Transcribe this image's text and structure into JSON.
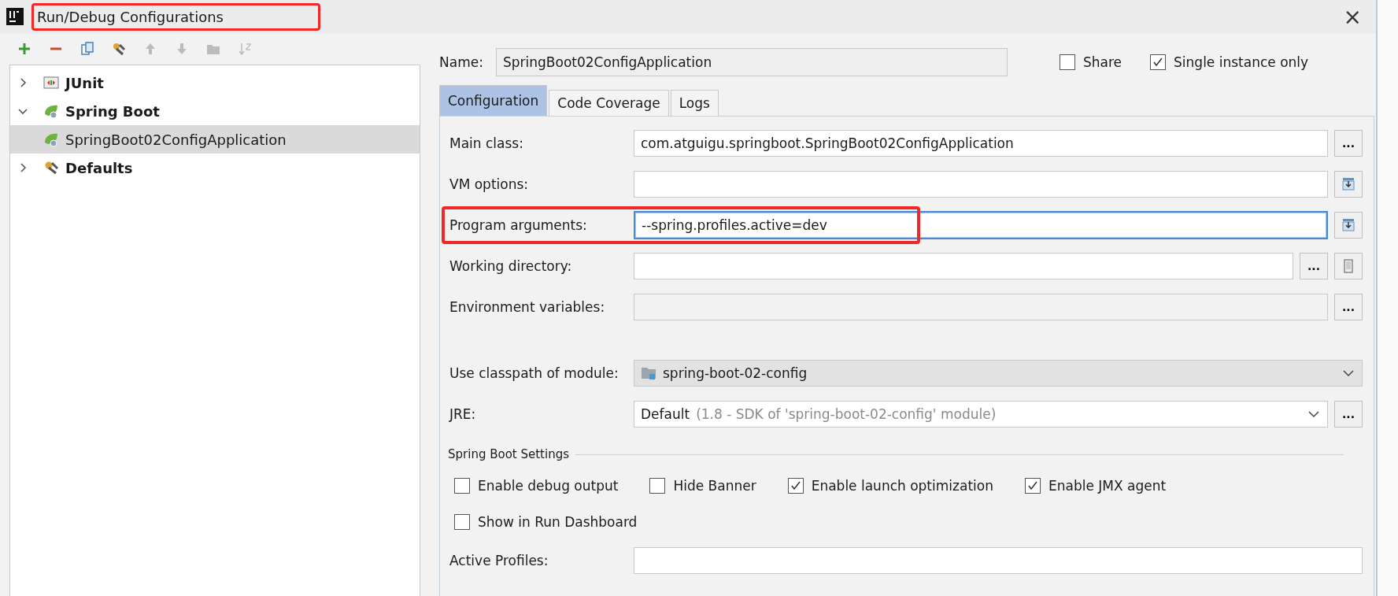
{
  "window": {
    "title": "Run/Debug Configurations",
    "highlighted": true,
    "close": "×"
  },
  "toolbar": [
    {
      "kind": "add",
      "disabled": false
    },
    {
      "kind": "remove",
      "disabled": false
    },
    {
      "kind": "copy",
      "disabled": false
    },
    {
      "kind": "edit",
      "disabled": false
    },
    {
      "kind": "up",
      "disabled": true
    },
    {
      "kind": "down",
      "disabled": true
    },
    {
      "kind": "folder",
      "disabled": true
    },
    {
      "kind": "sort",
      "disabled": true
    }
  ],
  "tree": [
    {
      "label": "JUnit",
      "kind": "junit",
      "expanded": false,
      "selected": false
    },
    {
      "label": "Spring Boot",
      "kind": "spring",
      "expanded": true,
      "selected": false,
      "children": [
        {
          "label": "SpringBoot02ConfigApplication",
          "kind": "spring",
          "selected": true
        }
      ]
    },
    {
      "label": "Defaults",
      "kind": "defaults",
      "expanded": false,
      "selected": false
    }
  ],
  "name": {
    "label": "Name:",
    "value": "SpringBoot02ConfigApplication"
  },
  "options": [
    {
      "label": "Share",
      "checked": false
    },
    {
      "label": "Single instance only",
      "checked": true
    }
  ],
  "tabs": [
    {
      "label": "Configuration",
      "selected": true
    },
    {
      "label": "Code Coverage",
      "selected": false
    },
    {
      "label": "Logs",
      "selected": false
    }
  ],
  "fields": [
    {
      "kind": "text",
      "label": "Main class:",
      "value": "com.atguigu.springboot.SpringBoot02ConfigApplication",
      "focused": false,
      "highlighted": false,
      "actions": [
        {
          "kind": "browse",
          "label": "..."
        }
      ]
    },
    {
      "kind": "text",
      "label": "VM options:",
      "focused": false,
      "highlighted": false,
      "actions": [
        {
          "kind": "expand"
        }
      ]
    },
    {
      "kind": "text",
      "label": "Program arguments:",
      "value": "--spring.profiles.active=dev",
      "focused": true,
      "highlighted": true,
      "actions": [
        {
          "kind": "expand"
        }
      ]
    },
    {
      "kind": "text",
      "label": "Working directory:",
      "focused": false,
      "highlighted": false,
      "actions": [
        {
          "kind": "browse",
          "label": "..."
        },
        {
          "kind": "macro"
        }
      ]
    },
    {
      "kind": "readonly",
      "label": "Environment variables:",
      "focused": false,
      "highlighted": false,
      "actions": [
        {
          "kind": "browse",
          "label": "..."
        }
      ]
    },
    {
      "kind": "module",
      "label": "Use classpath of module:",
      "value": "spring-boot-02-config",
      "focused": false,
      "highlighted": false
    },
    {
      "kind": "combo",
      "label": "JRE:",
      "value": "Default",
      "detail": "(1.8 - SDK of 'spring-boot-02-config' module)",
      "focused": false,
      "highlighted": false,
      "actions": [
        {
          "kind": "browse",
          "label": "..."
        }
      ]
    }
  ],
  "settings": {
    "title": "Spring Boot Settings",
    "rows": [
      [
        {
          "label": "Enable debug output",
          "checked": false
        },
        {
          "label": "Hide Banner",
          "checked": false
        },
        {
          "label": "Enable launch optimization",
          "checked": true
        },
        {
          "label": "Enable JMX agent",
          "checked": true
        }
      ],
      [
        {
          "label": "Show in Run Dashboard",
          "checked": false
        }
      ]
    ],
    "active_profiles": {
      "label": "Active Profiles:"
    }
  }
}
